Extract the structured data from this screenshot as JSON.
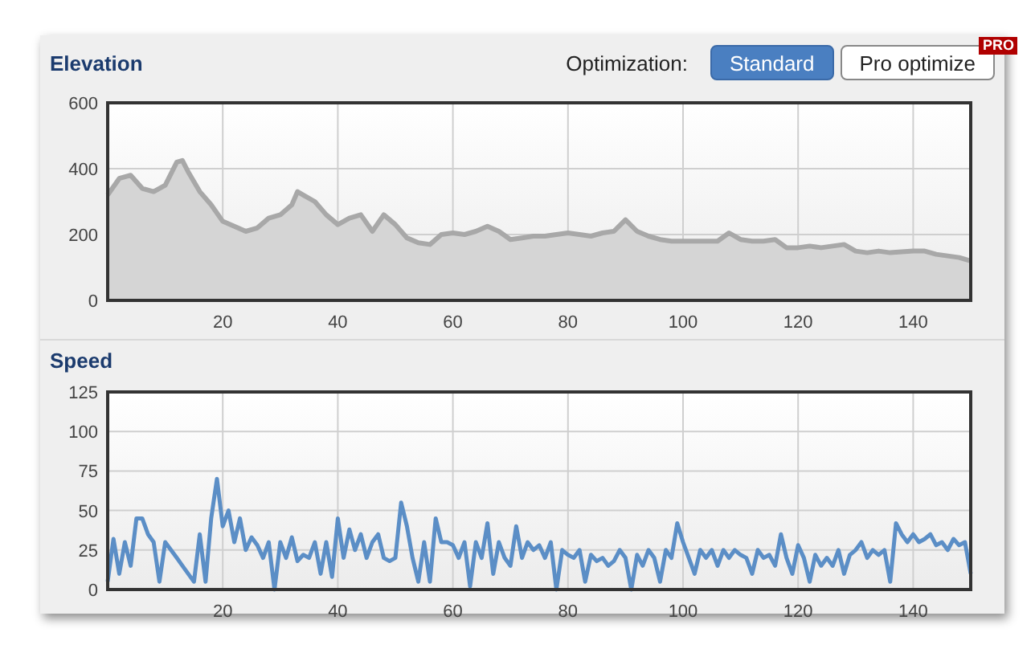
{
  "header": {
    "title": "Elevation",
    "optimization_label": "Optimization:",
    "options": [
      {
        "label": "Standard",
        "selected": true
      },
      {
        "label": "Pro optimize",
        "selected": false,
        "badge": "PRO"
      }
    ]
  },
  "elevation_chart": {
    "chart_data": {
      "type": "area",
      "xlim": [
        0,
        150
      ],
      "ylim": [
        0,
        600
      ],
      "xticks": [
        20,
        40,
        60,
        80,
        100,
        120,
        140
      ],
      "yticks": [
        0,
        200,
        400,
        600
      ],
      "x": [
        0,
        2,
        4,
        6,
        8,
        10,
        12,
        13,
        14,
        16,
        18,
        20,
        22,
        24,
        26,
        28,
        30,
        32,
        33,
        34,
        36,
        38,
        40,
        42,
        44,
        46,
        48,
        50,
        52,
        54,
        56,
        58,
        60,
        62,
        64,
        66,
        68,
        70,
        72,
        74,
        76,
        78,
        80,
        82,
        84,
        86,
        88,
        90,
        92,
        94,
        96,
        98,
        100,
        102,
        104,
        106,
        108,
        110,
        112,
        114,
        116,
        118,
        120,
        122,
        124,
        126,
        128,
        130,
        132,
        134,
        136,
        138,
        140,
        142,
        144,
        146,
        148,
        150
      ],
      "grid": true,
      "series": [
        {
          "color": "#a8a8a8",
          "values": [
            320,
            370,
            380,
            340,
            330,
            350,
            420,
            425,
            390,
            330,
            290,
            240,
            225,
            210,
            220,
            250,
            260,
            290,
            330,
            320,
            300,
            260,
            230,
            250,
            260,
            210,
            260,
            230,
            190,
            175,
            170,
            200,
            205,
            200,
            210,
            225,
            210,
            185,
            190,
            195,
            195,
            200,
            205,
            200,
            195,
            205,
            210,
            245,
            210,
            195,
            185,
            180,
            180,
            180,
            180,
            180,
            205,
            185,
            180,
            180,
            185,
            160,
            160,
            165,
            160,
            165,
            170,
            150,
            145,
            150,
            145,
            148,
            150,
            150,
            140,
            135,
            130,
            120
          ]
        }
      ]
    }
  },
  "speed_panel": {
    "title": "Speed",
    "chart_data": {
      "type": "line",
      "xlim": [
        0,
        150
      ],
      "ylim": [
        0,
        125
      ],
      "xticks": [
        20,
        40,
        60,
        80,
        100,
        120,
        140
      ],
      "yticks": [
        0,
        25,
        50,
        75,
        100,
        125
      ],
      "x": [
        0,
        1,
        2,
        3,
        4,
        5,
        6,
        7,
        8,
        9,
        10,
        11,
        12,
        13,
        14,
        15,
        16,
        17,
        18,
        19,
        20,
        21,
        22,
        23,
        24,
        25,
        26,
        27,
        28,
        29,
        30,
        31,
        32,
        33,
        34,
        35,
        36,
        37,
        38,
        39,
        40,
        41,
        42,
        43,
        44,
        45,
        46,
        47,
        48,
        49,
        50,
        51,
        52,
        53,
        54,
        55,
        56,
        57,
        58,
        59,
        60,
        61,
        62,
        63,
        64,
        65,
        66,
        67,
        68,
        69,
        70,
        71,
        72,
        73,
        74,
        75,
        76,
        77,
        78,
        79,
        80,
        81,
        82,
        83,
        84,
        85,
        86,
        87,
        88,
        89,
        90,
        91,
        92,
        93,
        94,
        95,
        96,
        97,
        98,
        99,
        100,
        101,
        102,
        103,
        104,
        105,
        106,
        107,
        108,
        109,
        110,
        111,
        112,
        113,
        114,
        115,
        116,
        117,
        118,
        119,
        120,
        121,
        122,
        123,
        124,
        125,
        126,
        127,
        128,
        129,
        130,
        131,
        132,
        133,
        134,
        135,
        136,
        137,
        138,
        139,
        140,
        141,
        142,
        143,
        144,
        145,
        146,
        147,
        148,
        149,
        150
      ],
      "grid": true,
      "series": [
        {
          "color": "#5b8ec6",
          "values": [
            5,
            32,
            10,
            30,
            15,
            45,
            45,
            35,
            30,
            5,
            30,
            25,
            20,
            15,
            10,
            5,
            35,
            5,
            45,
            70,
            40,
            50,
            30,
            45,
            25,
            33,
            28,
            20,
            30,
            0,
            30,
            20,
            33,
            18,
            22,
            20,
            30,
            10,
            30,
            8,
            45,
            20,
            38,
            25,
            35,
            20,
            30,
            35,
            20,
            18,
            20,
            55,
            40,
            20,
            5,
            30,
            5,
            45,
            30,
            30,
            28,
            20,
            30,
            2,
            30,
            20,
            42,
            10,
            30,
            20,
            15,
            40,
            20,
            30,
            25,
            28,
            20,
            30,
            0,
            25,
            22,
            20,
            25,
            5,
            22,
            18,
            20,
            15,
            18,
            25,
            20,
            0,
            22,
            15,
            25,
            20,
            5,
            25,
            20,
            42,
            30,
            20,
            10,
            25,
            20,
            25,
            15,
            25,
            20,
            25,
            22,
            20,
            10,
            25,
            20,
            22,
            15,
            35,
            20,
            10,
            28,
            20,
            5,
            22,
            15,
            20,
            15,
            25,
            10,
            22,
            25,
            30,
            20,
            25,
            22,
            25,
            5,
            42,
            35,
            30,
            35,
            30,
            32,
            35,
            28,
            30,
            25,
            32,
            28,
            30,
            10
          ]
        }
      ]
    }
  }
}
